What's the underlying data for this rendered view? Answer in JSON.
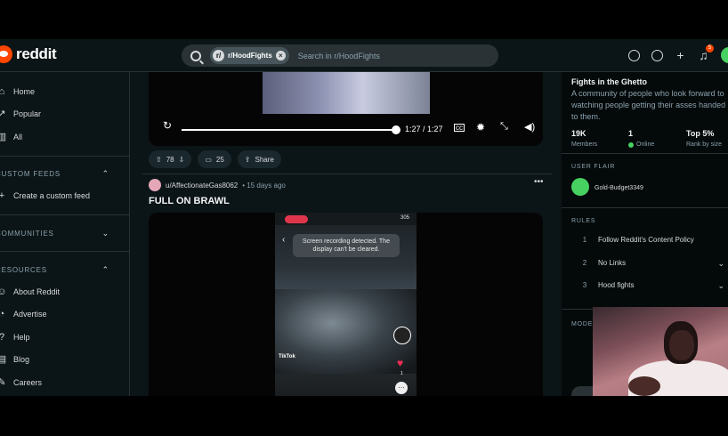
{
  "header": {
    "logo_text": "reddit",
    "search_chip": "r/HoodFights",
    "chip_close": "×",
    "search_placeholder": "Search in r/HoodFights",
    "notif_count": "5",
    "icons": [
      "advertise-icon",
      "chat-icon",
      "create-icon",
      "notification-icon",
      "user-avatar"
    ]
  },
  "sidebar": {
    "items": [
      {
        "label": "Home",
        "icon": "⌂"
      },
      {
        "label": "Popular",
        "icon": "↗"
      },
      {
        "label": "All",
        "icon": "▥"
      }
    ],
    "custom_feeds_head": "CUSTOM FEEDS",
    "create_feed": "Create a custom feed",
    "communities_head": "COMMUNITIES",
    "resources_head": "RESOURCES",
    "resources": [
      {
        "label": "About Reddit",
        "icon": "☺"
      },
      {
        "label": "Advertise",
        "icon": "◔"
      },
      {
        "label": "Help",
        "icon": "?"
      },
      {
        "label": "Blog",
        "icon": "▤"
      },
      {
        "label": "Careers",
        "icon": "✎"
      }
    ]
  },
  "video1": {
    "time": "1:27 / 1:27",
    "progress": 1.0
  },
  "actions": {
    "upvotes": "78",
    "comments": "25",
    "share": "Share"
  },
  "post": {
    "user": "u/AffectionateGas8062",
    "time": "• 15 days ago",
    "title": "FULL ON BRAWL",
    "toast_line1": "Screen recording detected. The",
    "toast_line2": "display can't be cleared.",
    "status_right": "305",
    "tiktok": "TikTok",
    "tiktok_count": "1"
  },
  "community": {
    "title": "Fights in the Ghetto",
    "description": "A community of people who look forward to watching people getting their asses handed to them.",
    "members": "19K",
    "members_label": "Members",
    "online": "1",
    "online_label": "Online",
    "rank": "Top 5%",
    "rank_label": "Rank by size",
    "flair_head": "USER FLAIR",
    "flair_name": "Gold-Budget3349",
    "rules_head": "RULES",
    "rules": [
      {
        "num": "1",
        "text": "Follow Reddit's Content Policy"
      },
      {
        "num": "2",
        "text": "No Links"
      },
      {
        "num": "3",
        "text": "Hood fights"
      }
    ],
    "mod_head": "MODERA"
  },
  "colors": {
    "bg": "#0b1416",
    "accent": "#ff4500",
    "online": "#46d160"
  }
}
